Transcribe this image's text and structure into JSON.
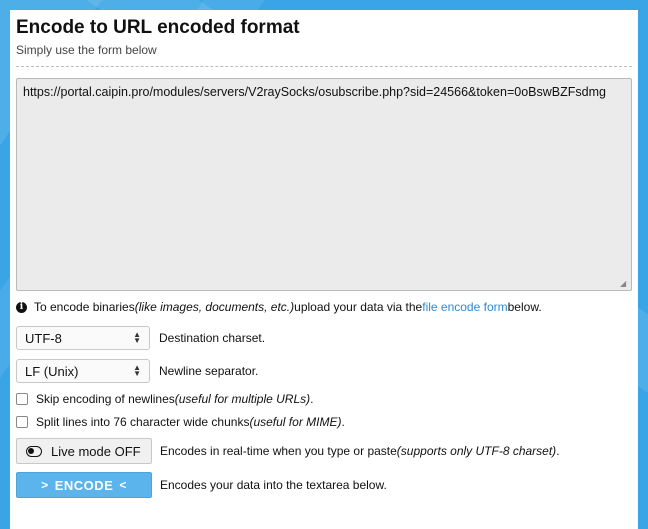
{
  "header": {
    "title": "Encode to URL encoded format",
    "subtitle": "Simply use the form below"
  },
  "input": {
    "value": "https://portal.caipin.pro/modules/servers/V2raySocks/osubscribe.php?sid=24566&token=0oBswBZFsdmg"
  },
  "info": {
    "icon": "info-icon",
    "prefix": "To encode binaries ",
    "italic": "(like images, documents, etc.)",
    "middle": " upload your data via the ",
    "link": "file encode form",
    "suffix": " below."
  },
  "charset": {
    "selected": "UTF-8",
    "label": "Destination charset."
  },
  "newline": {
    "selected": "LF (Unix)",
    "label": "Newline separator."
  },
  "options": {
    "skip_newlines": {
      "label": "Skip encoding of newlines ",
      "hint": "(useful for multiple URLs)",
      "end": "."
    },
    "split_lines": {
      "label": "Split lines into 76 character wide chunks ",
      "hint": "(useful for MIME)",
      "end": "."
    }
  },
  "live_mode": {
    "label": "Live mode OFF",
    "desc": "Encodes in real-time when you type or paste ",
    "hint": "(supports only UTF-8 charset)",
    "end": "."
  },
  "encode": {
    "label": "ENCODE",
    "desc": "Encodes your data into the textarea below."
  },
  "colors": {
    "background": "#3aa5e6",
    "accent": "#5cb4ec",
    "link": "#2a8ad4"
  }
}
